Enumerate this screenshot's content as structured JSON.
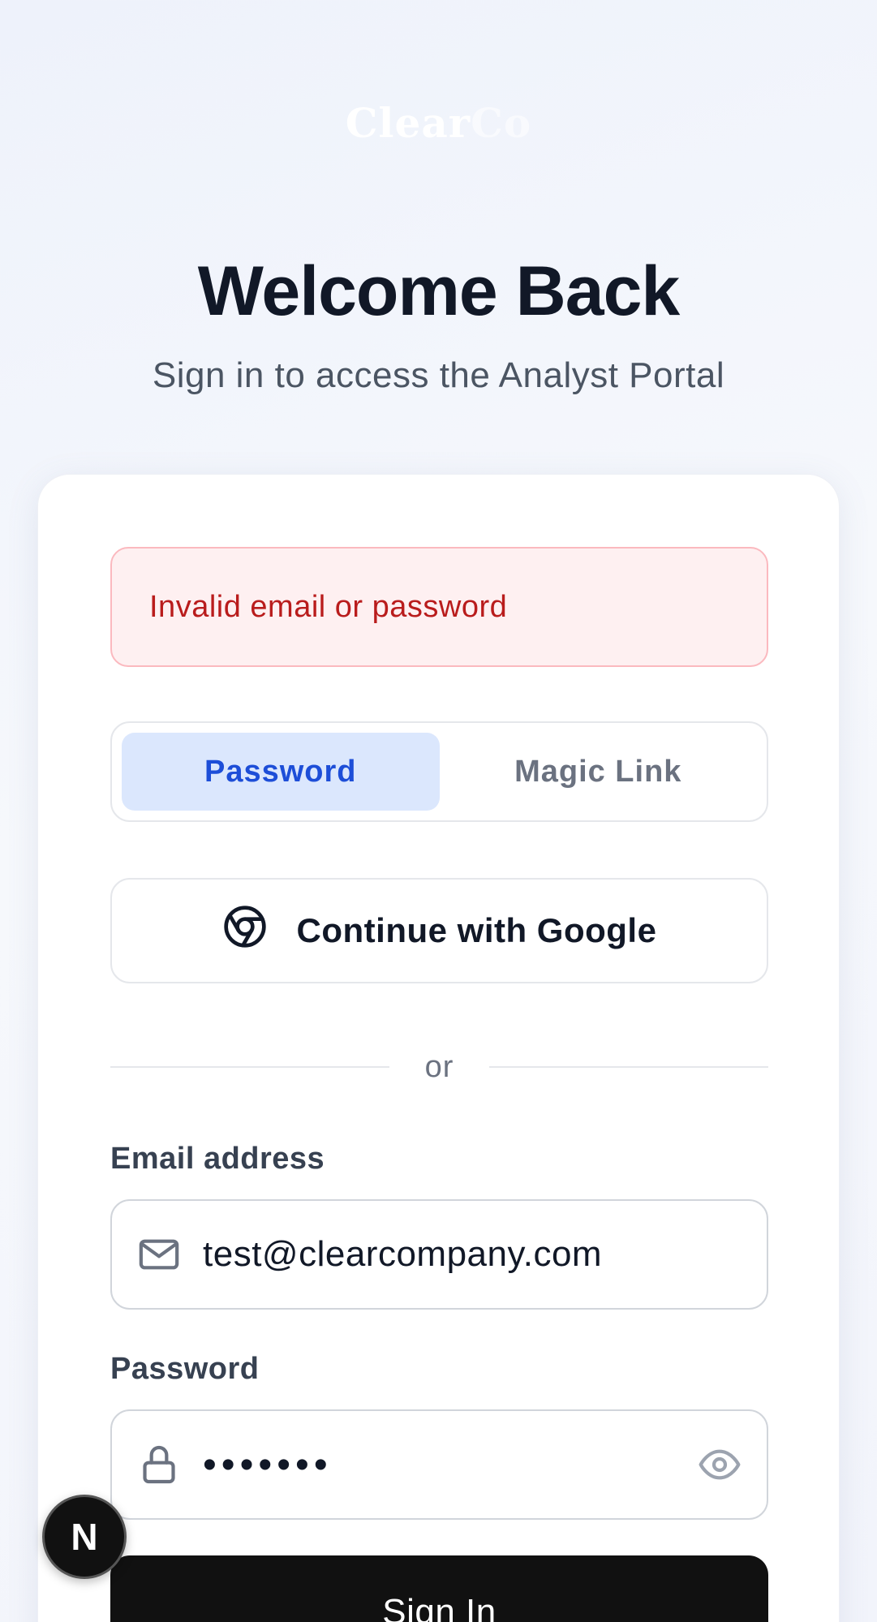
{
  "brand": {
    "name_main": "Clear",
    "name_suffix": "Co"
  },
  "header": {
    "title": "Welcome Back",
    "subtitle": "Sign in to access the Analyst Portal"
  },
  "alert": {
    "message": "Invalid email or password"
  },
  "tabs": [
    {
      "label": "Password",
      "active": true
    },
    {
      "label": "Magic Link",
      "active": false
    }
  ],
  "google_button": {
    "label": "Continue with Google",
    "icon": "chrome-icon"
  },
  "divider": {
    "text": "or"
  },
  "email": {
    "label": "Email address",
    "value": "test@clearcompany.com",
    "icon": "mail-icon"
  },
  "password": {
    "label": "Password",
    "masked_value": "•••••••",
    "icon": "lock-icon",
    "toggle_icon": "eye-icon"
  },
  "submit": {
    "label": "Sign In"
  },
  "dev_badge": {
    "text": "N"
  },
  "colors": {
    "accent": "#1d4ed8",
    "accent_bg": "#dbe7fd",
    "error": "#b91c1c",
    "error_bg": "#fef0f1",
    "primary_button": "#111111"
  }
}
